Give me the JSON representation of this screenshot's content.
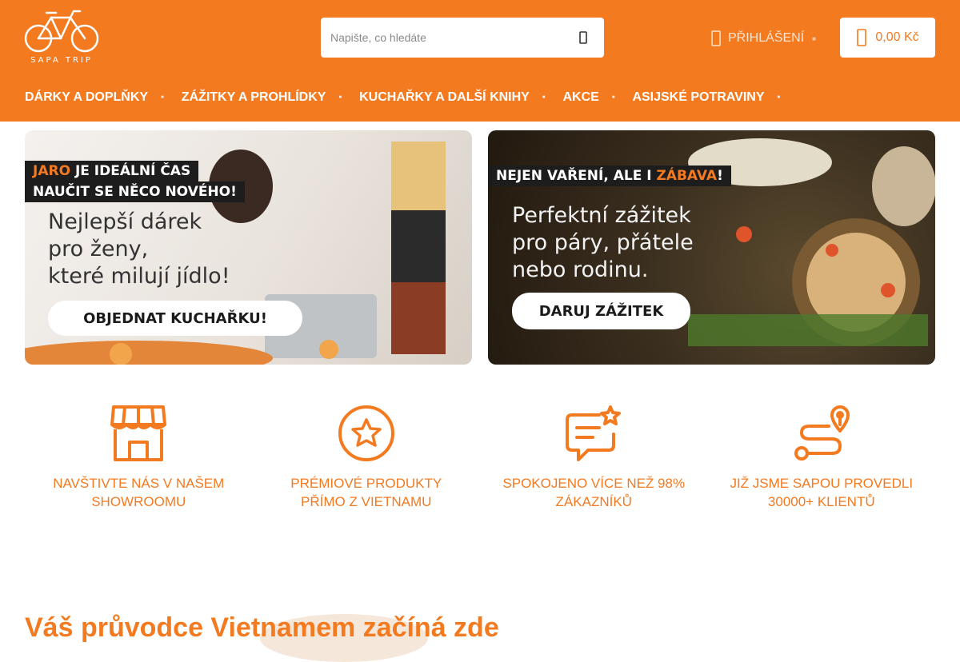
{
  "header": {
    "logo_text": "SAPA TRIP",
    "search": {
      "placeholder": "Napište, co hledáte"
    },
    "login_label": "PŘIHLÁŠENÍ",
    "cart_total": "0,00 Kč"
  },
  "nav": {
    "items": [
      {
        "label": "DÁRKY A DOPLŇKY"
      },
      {
        "label": "ZÁŽITKY A PROHLÍDKY"
      },
      {
        "label": "KUCHAŘKY A DALŠÍ KNIHY"
      },
      {
        "label": "AKCE"
      },
      {
        "label": "ASIJSKÉ POTRAVINY"
      }
    ]
  },
  "banners": [
    {
      "tag1_accent": "JARO",
      "tag1_rest": " JE IDEÁLNÍ ČAS",
      "tag2": "NAUČIT SE NĚCO NOVÉHO!",
      "lines": [
        "Nejlepší dárek",
        "pro ženy,",
        "které milují jídlo!"
      ],
      "cta": "OBJEDNAT KUCHAŘKU!"
    },
    {
      "tag_start": "NEJEN VAŘENÍ, ALE I ",
      "tag_accent": "ZÁBAVA",
      "tag_end": "!",
      "lines": [
        "Perfektní zážitek",
        "pro páry, přátele",
        "nebo rodinu."
      ],
      "cta": "DARUJ ZÁŽITEK"
    }
  ],
  "features": [
    {
      "icon": "store-icon",
      "label": "NAVŠTIVTE NÁS V NAŠEM SHOWROOMU"
    },
    {
      "icon": "star-badge-icon",
      "label": "PRÉMIOVÉ PRODUKTY PŘÍMO Z VIETNAMU"
    },
    {
      "icon": "chat-star-icon",
      "label": "SPOKOJENO VÍCE NEŽ 98% ZÁKAZNÍKŮ"
    },
    {
      "icon": "route-icon",
      "label": "JIŽ JSME SAPOU PROVEDLI 30000+ KLIENTŮ"
    }
  ],
  "section_title": "Váš průvodce Vietnamem začíná zde",
  "colors": {
    "brand": "#f47a20",
    "dark": "#1d1d1d"
  }
}
